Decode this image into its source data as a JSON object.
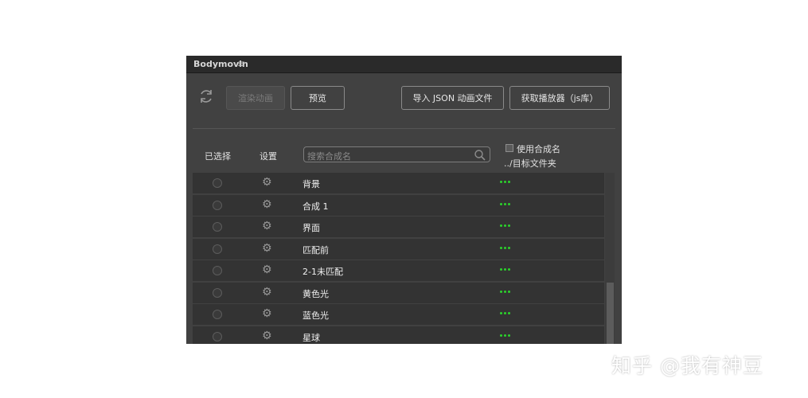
{
  "window": {
    "title": "Bodymovin",
    "menu_icon": "≡"
  },
  "toolbar": {
    "refresh_icon": "refresh-icon",
    "render_label": "渲染动画",
    "preview_label": "预览",
    "import_label": "导入 JSON 动画文件",
    "player_label": "获取播放器（js库）"
  },
  "columns": {
    "selected": "已选择",
    "settings": "设置",
    "search_placeholder": "搜索合成名",
    "use_comp_name": "使用合成名",
    "dest_folder": "../目标文件夹"
  },
  "compositions": [
    {
      "name": "背景"
    },
    {
      "name": "合成 1"
    },
    {
      "name": "界面"
    },
    {
      "name": "匹配前"
    },
    {
      "name": "2-1未匹配"
    },
    {
      "name": "黄色光"
    },
    {
      "name": "蓝色光"
    },
    {
      "name": "星球"
    }
  ],
  "colors": {
    "accent_green": "#2bd22b",
    "panel": "#414141",
    "row": "#333333"
  },
  "watermark": "知乎 @我有神豆"
}
